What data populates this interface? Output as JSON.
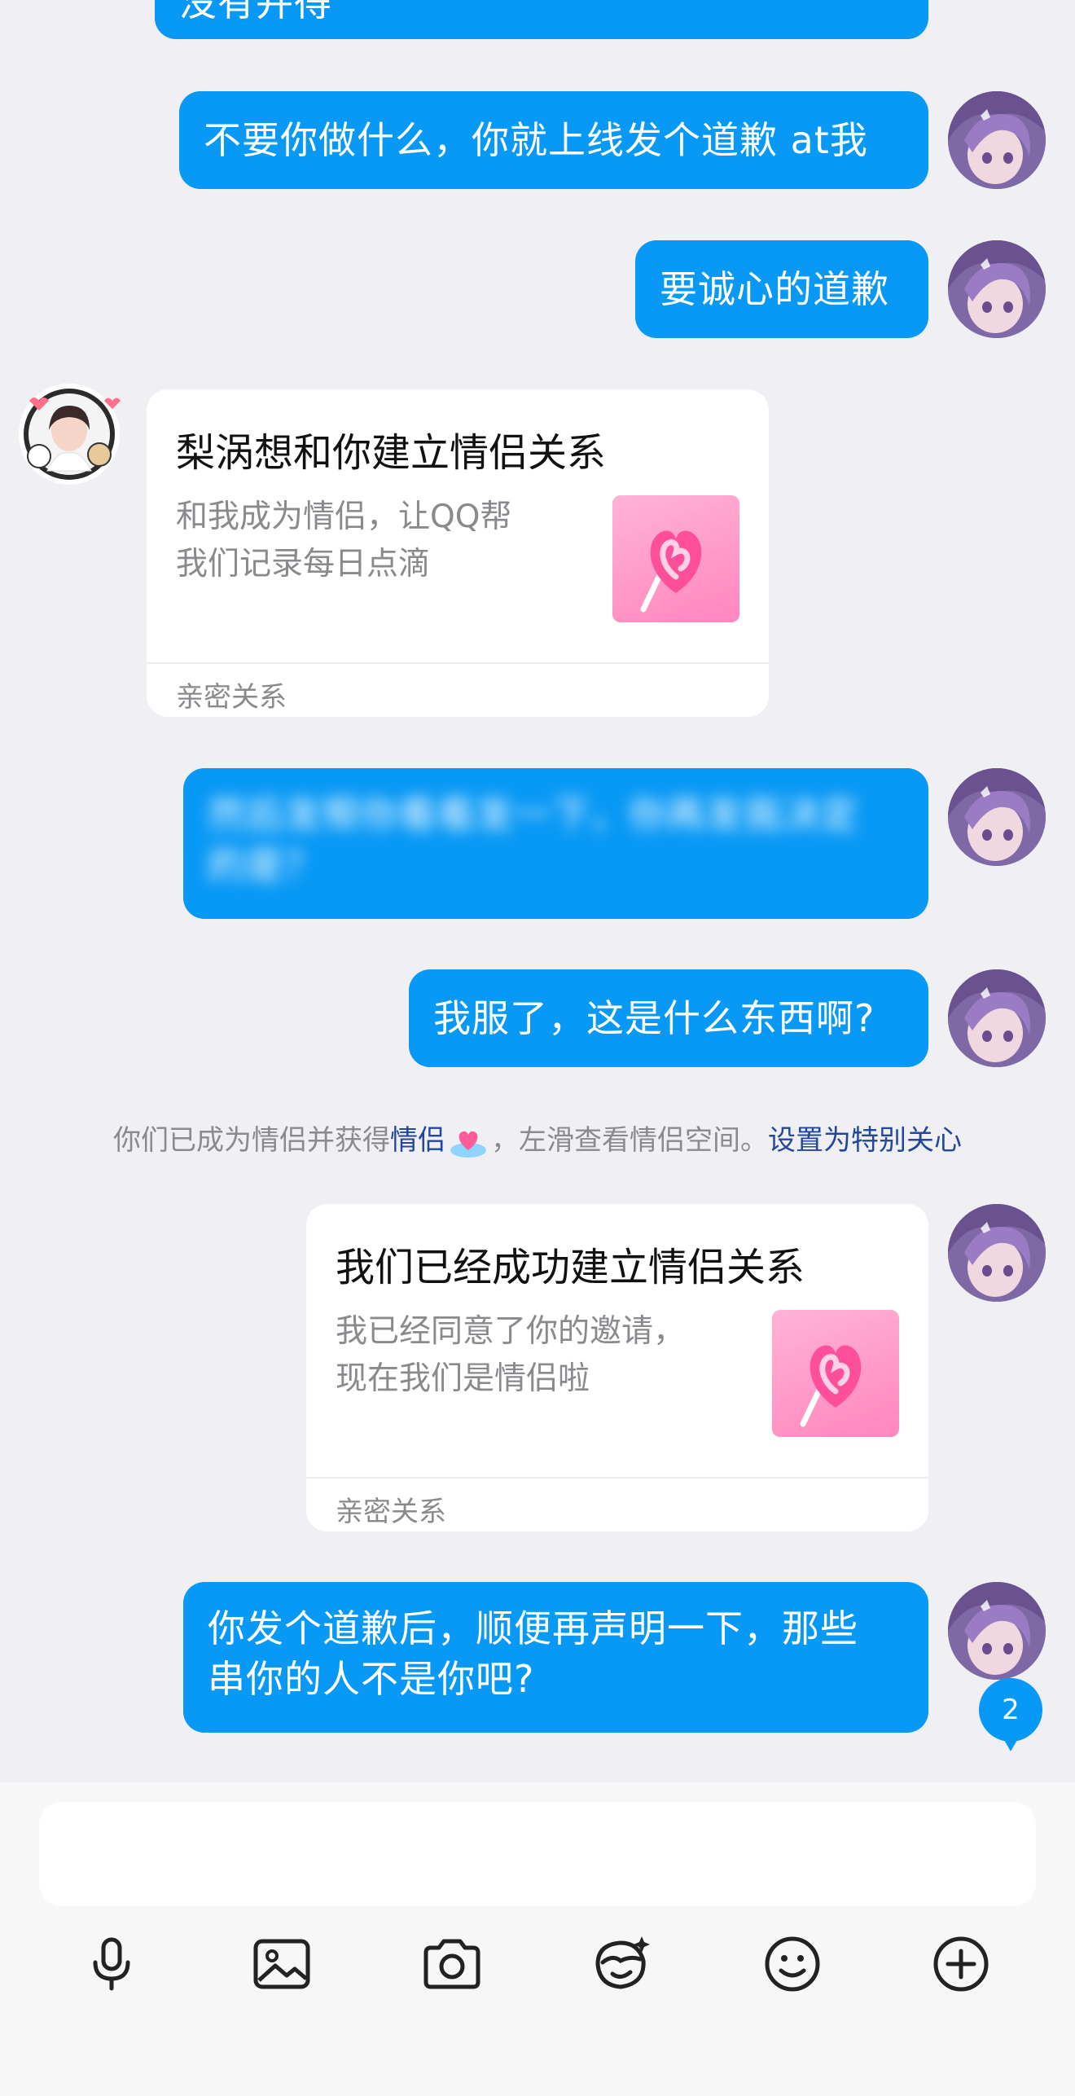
{
  "messages": {
    "m0": "没有并得",
    "m1": "不要你做什么，你就上线发个道歉 at我",
    "m2": "要诚心的道歉",
    "m4_line1": "然后发帮你看看发一下，你再发我决定",
    "m4_line2": "的是？",
    "m5": "我服了，这是什么东西啊?",
    "m8_line1": "你发个道歉后，顺便再声明一下，那些",
    "m8_line2": "串你的人不是你吧?"
  },
  "invite_card": {
    "title": "梨涡想和你建立情侣关系",
    "desc_line1": "和我成为情侣，让QQ帮",
    "desc_line2": "我们记录每日点滴",
    "footer": "亲密关系"
  },
  "system_notice": {
    "prefix": "你们已成为情侣并获得",
    "badge_link": "情侣",
    "middle": "，左滑查看情侣空间。",
    "action_link": "设置为特别关心"
  },
  "accept_card": {
    "title": "我们已经成功建立情侣关系",
    "desc_line1": "我已经同意了你的邀请，",
    "desc_line2": "现在我们是情侣啦",
    "footer": "亲密关系"
  },
  "unread_count": "2",
  "input": {
    "placeholder": ""
  },
  "toolbar": {
    "icons": [
      "microphone-icon",
      "image-icon",
      "camera-icon",
      "sticker-icon",
      "emoji-icon",
      "plus-icon"
    ]
  },
  "colors": {
    "bubble": "#0898f5",
    "background": "#f0f0f4",
    "link": "#23479a",
    "card_thumb": "#ff86bd"
  }
}
